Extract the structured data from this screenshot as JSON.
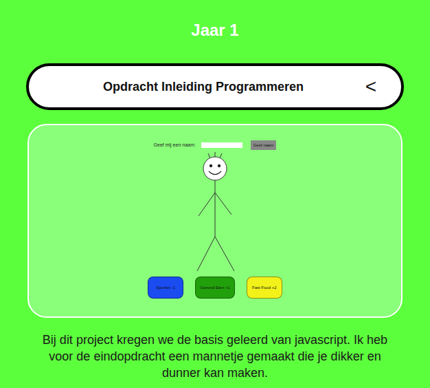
{
  "heading": "Jaar 1",
  "accordion": {
    "title": "Opdracht Inleiding Programmeren",
    "toggle": "<",
    "expanded": true
  },
  "preview": {
    "name_label": "Geef mij een naam:",
    "name_value": "",
    "name_button": "Geef naam",
    "actions": [
      {
        "label": "Sporten -1",
        "color": "#1a4cf0"
      },
      {
        "label": "Gezond Eten +1",
        "color": "#22a00c"
      },
      {
        "label": "Fast Food +2",
        "color": "#f2f21a"
      }
    ]
  },
  "description": "Bij dit project kregen we de basis geleerd van javascript. Ik heb voor de eindopdracht een mannetje gemaakt die je dikker en dunner kan maken."
}
